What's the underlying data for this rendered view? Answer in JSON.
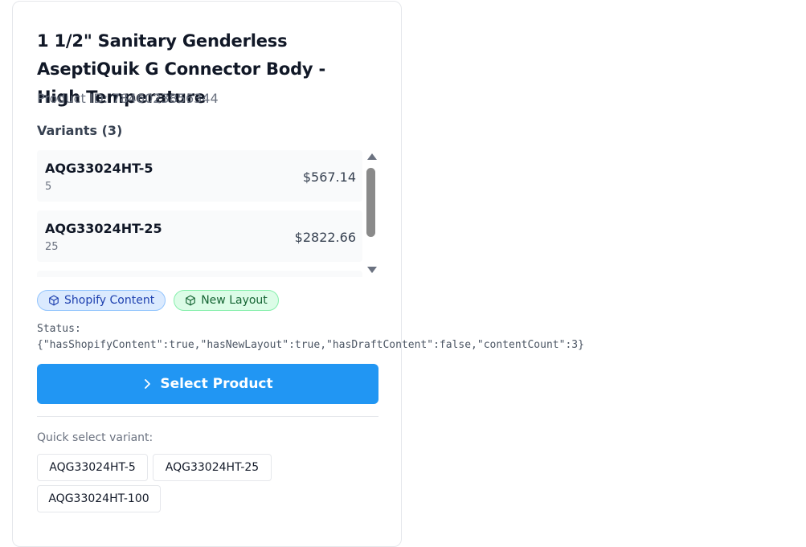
{
  "product": {
    "title": "1 1/2\" Sanitary Genderless AseptiQuik G Connector Body - High Temperature",
    "product_id": "Product ID: 7846023856344"
  },
  "variants": {
    "heading": "Variants (3)",
    "items": [
      {
        "sku": "AQG33024HT-5",
        "qty": "5",
        "price": "$567.14"
      },
      {
        "sku": "AQG33024HT-25",
        "qty": "25",
        "price": "$2822.66"
      }
    ]
  },
  "badges": [
    {
      "label": "Shopify Content",
      "icon": "cube-icon",
      "color": "#1e40af"
    },
    {
      "label": "New Layout",
      "icon": "cube-icon",
      "color": "#166534"
    }
  ],
  "status": {
    "label": "Status:",
    "json": "{\"hasShopifyContent\":true,\"hasNewLayout\":true,\"hasDraftContent\":false,\"contentCount\":3}"
  },
  "select_button": {
    "label": "Select Product",
    "icon": "chevron-right-icon",
    "color": "#2196f3"
  },
  "quick_select": {
    "label": "Quick select variant:",
    "options": [
      "AQG33024HT-5",
      "AQG33024HT-25",
      "AQG33024HT-100"
    ]
  }
}
